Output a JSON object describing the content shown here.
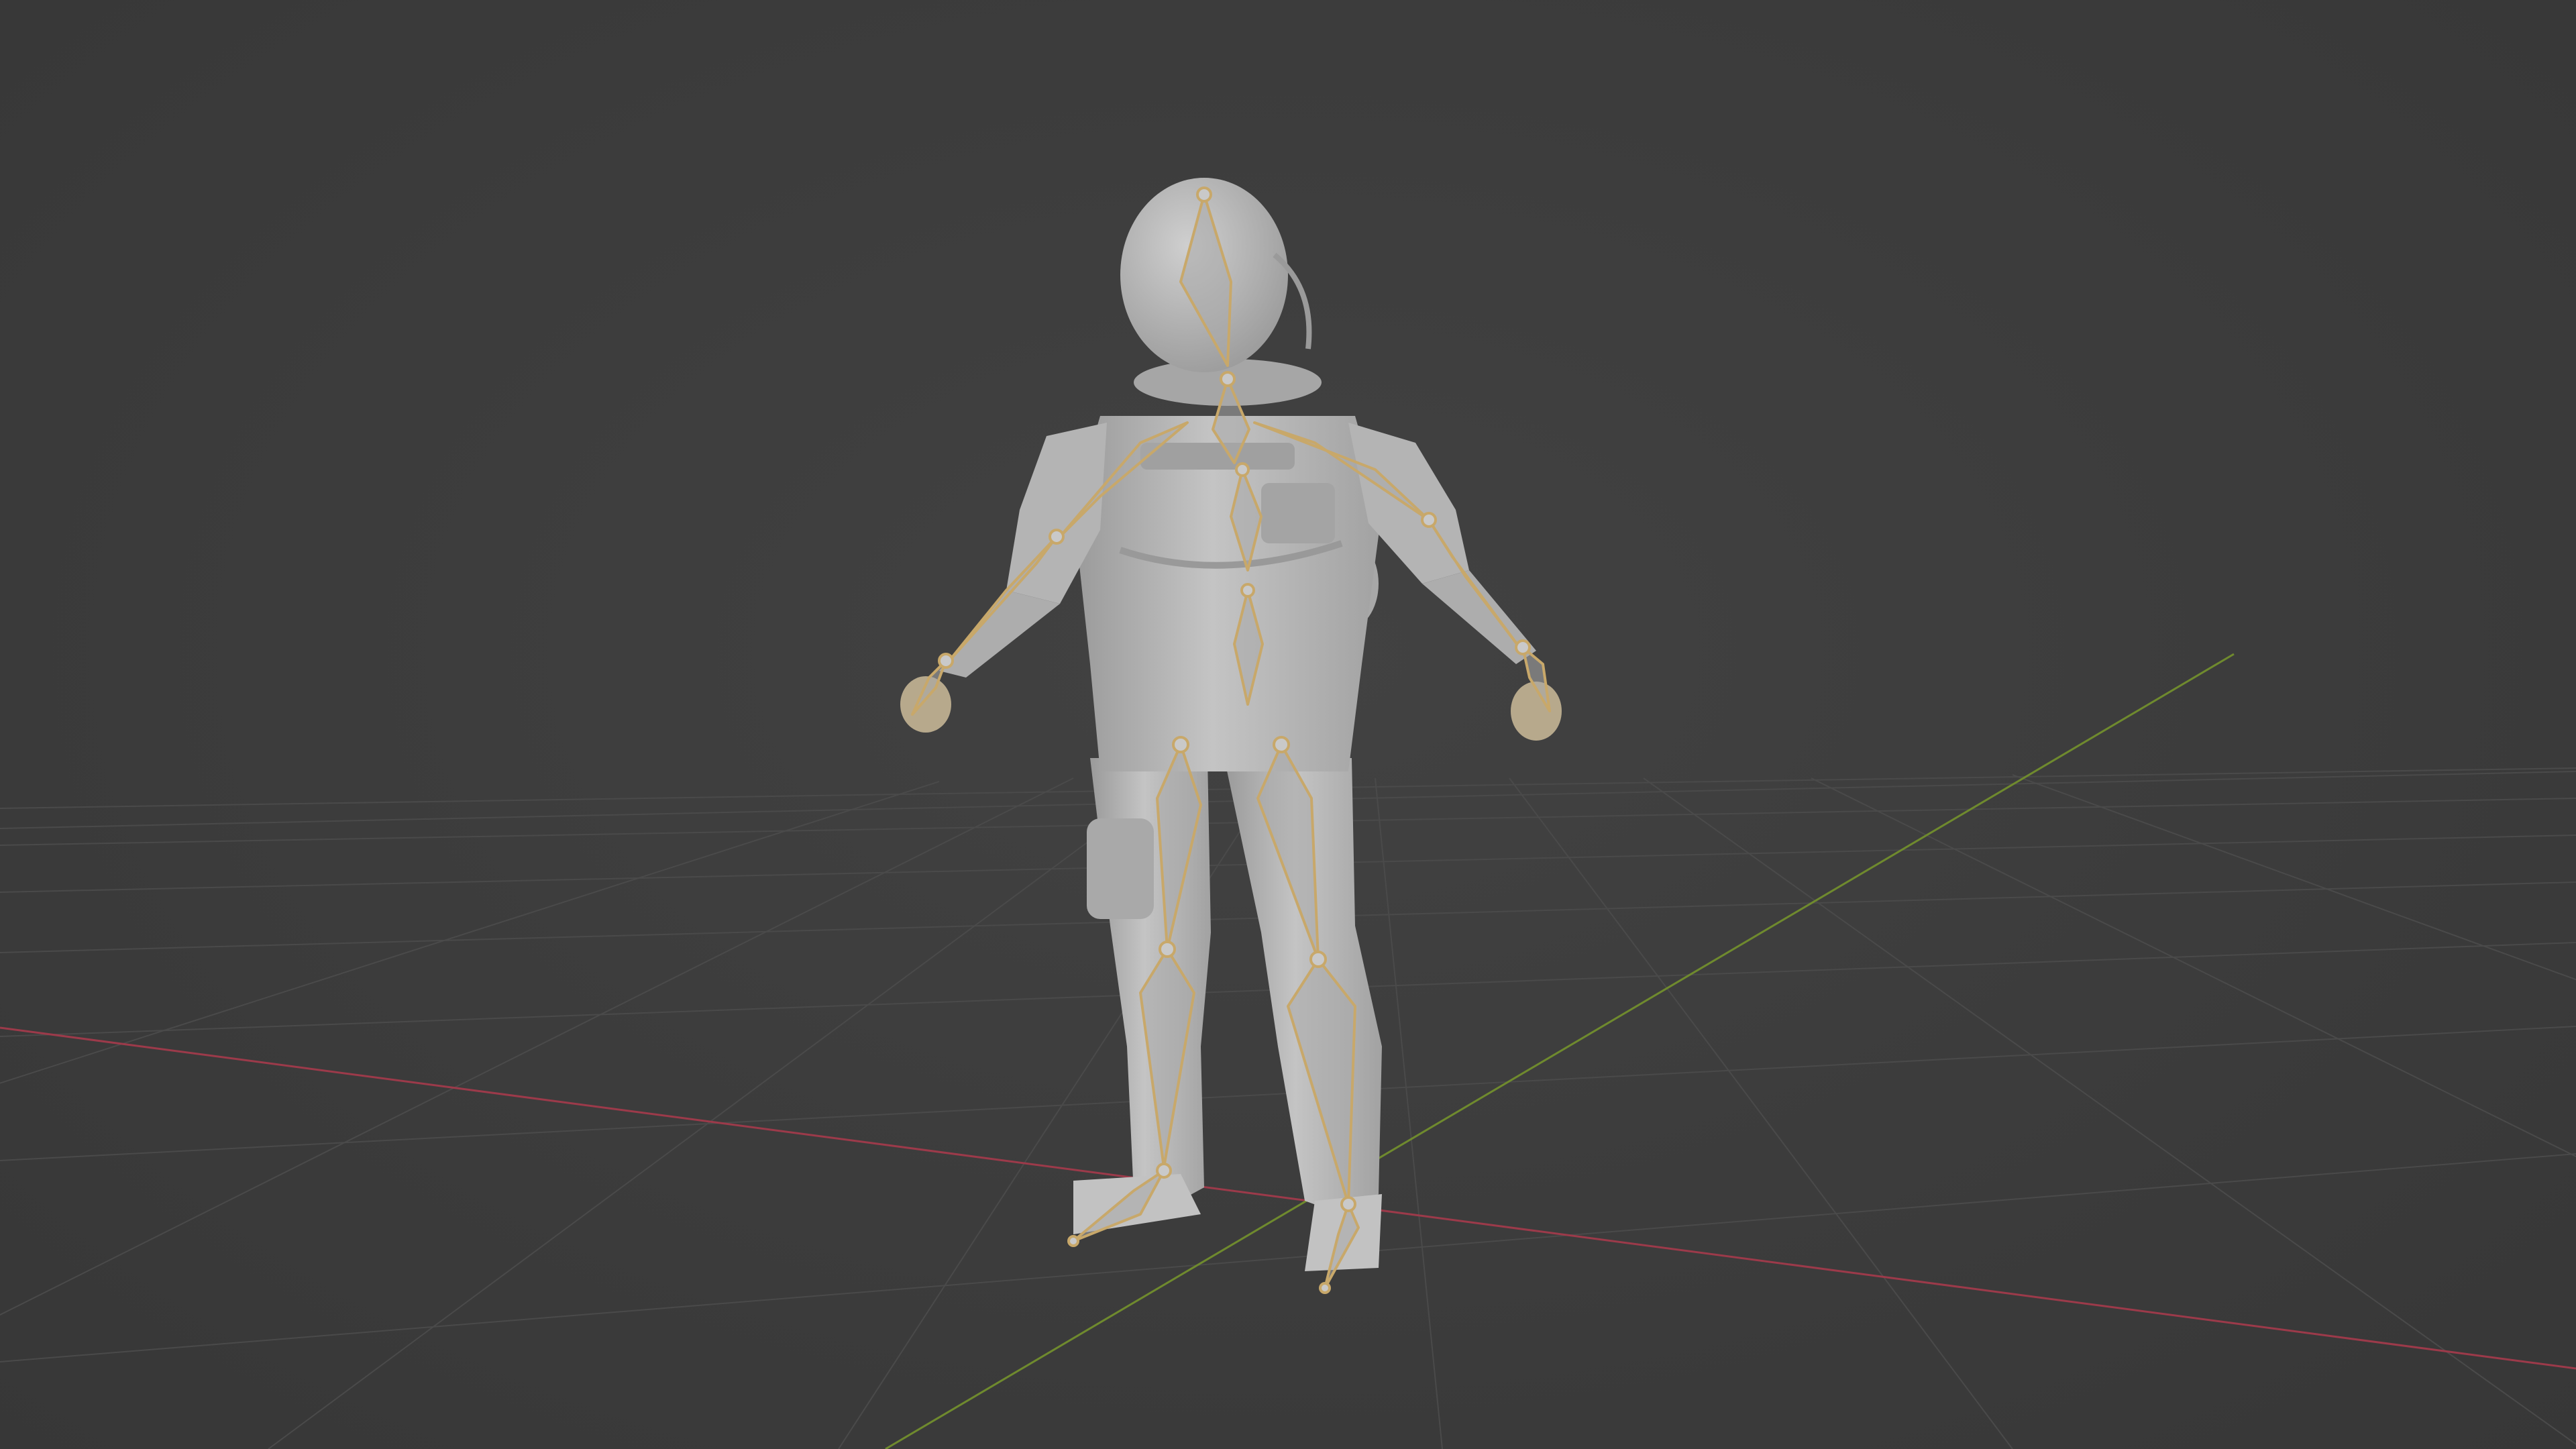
{
  "viewport": {
    "background": "#3d3d3d",
    "grid_color": "#4a4a4a",
    "x_axis_color": "#9c3a4a",
    "y_axis_color": "#6f8a2e",
    "model_color": "#b8b8b8",
    "model_shadow_color": "#8e8e8e",
    "armature_color": "#c8a86a",
    "model": "astronaut-mesh",
    "armature": "armature-rig",
    "mode": "object-mode"
  }
}
